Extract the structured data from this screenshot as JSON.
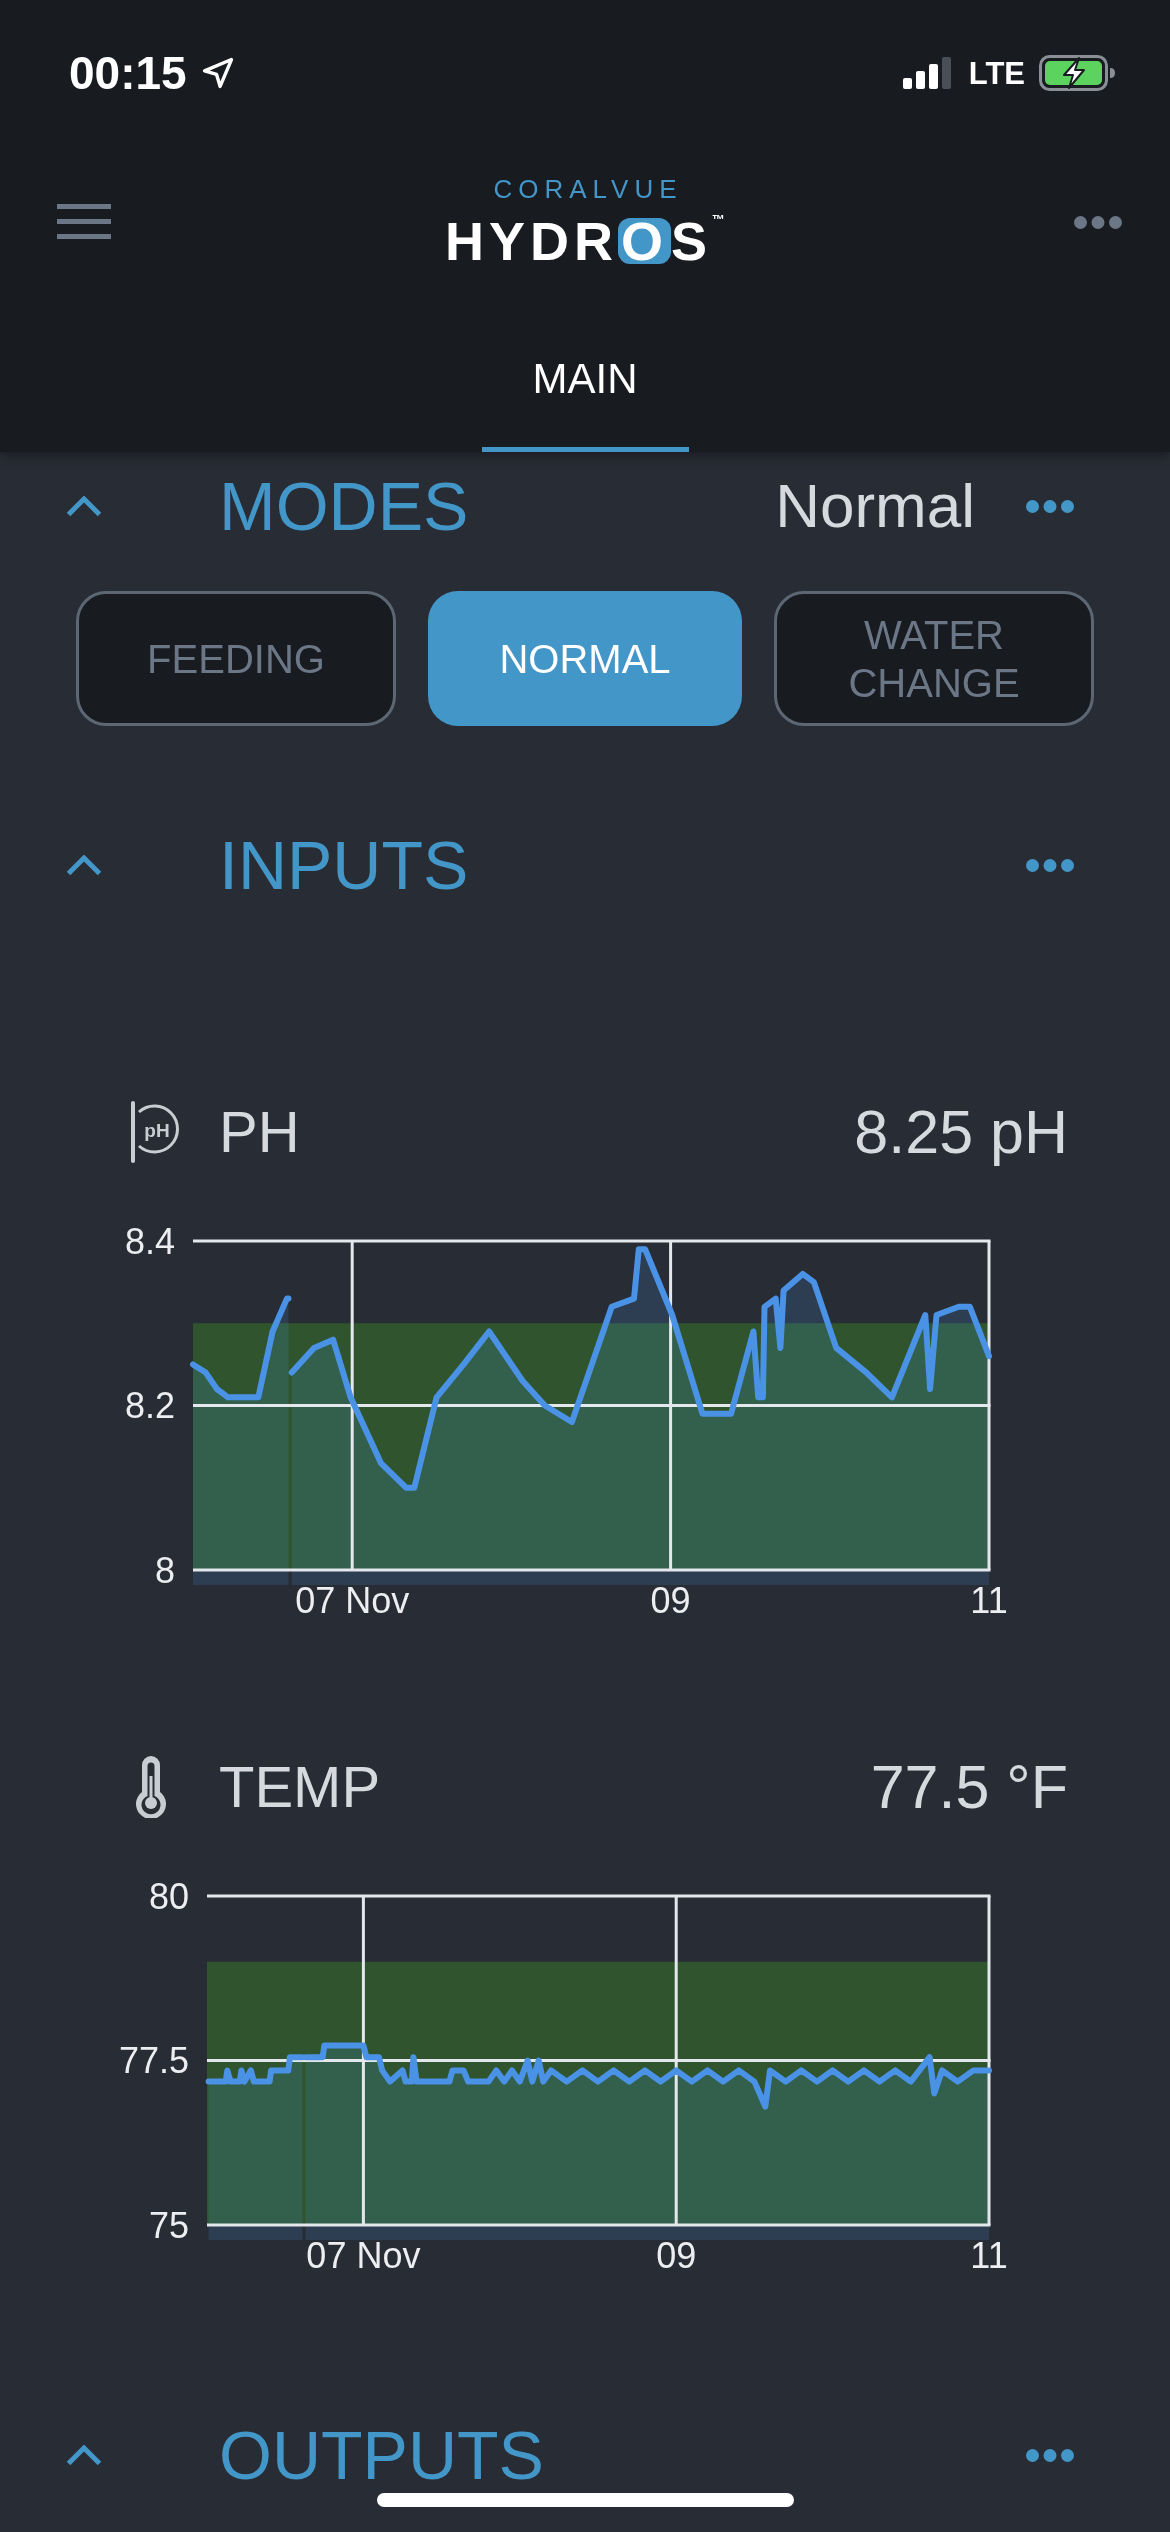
{
  "status_bar": {
    "time": "00:15",
    "network": "LTE"
  },
  "header": {
    "logo": {
      "brand": "CORALVUE",
      "product": "HYDR**O**S$^{™}$"
    },
    "tabs": [
      {
        "label": "MAIN",
        "selected": true
      }
    ]
  },
  "sections": [
    {
      "kind": "modes",
      "title": "MODES",
      "expanded": true,
      "current": "Normal",
      "modes": [
        {
          "label": "FEEDING",
          "selected": false
        },
        {
          "label": "NORMAL",
          "selected": true
        },
        {
          "label": "WATER CHANGE",
          "selected": false
        }
      ]
    },
    {
      "kind": "inputs",
      "title": "INPUTS",
      "expanded": true,
      "inputs": [
        {
          "kind": "ph",
          "name": "PH",
          "icon_text": "pH",
          "reading": "8.25 pH",
          "chart_data": {
            "type": "area",
            "x": [
              6.0,
              6.08,
              6.15,
              6.22,
              6.41,
              6.5,
              6.59,
              6.6,
              6.62,
              6.76,
              6.88,
              6.99,
              7.18,
              7.34,
              7.39,
              7.53,
              7.7,
              7.86,
              8.07,
              8.21,
              8.38,
              8.47,
              8.63,
              8.77,
              8.8,
              8.84,
              9.01,
              9.2,
              9.38,
              9.52,
              9.55,
              9.58,
              9.59,
              9.66,
              9.69,
              9.71,
              9.83,
              9.9,
              10.04,
              10.23,
              10.39,
              10.6,
              10.63,
              10.67,
              10.81,
              10.88,
              11.0
            ],
            "series": [
              {
                "color": "#4a92e6",
                "values": [
                  8.25,
                  8.24,
                  8.22,
                  8.21,
                  8.21,
                  8.29,
                  8.33,
                  null,
                  8.24,
                  8.27,
                  8.28,
                  8.21,
                  8.13,
                  8.1,
                  8.1,
                  8.21,
                  8.25,
                  8.29,
                  8.23,
                  8.2,
                  8.18,
                  8.23,
                  8.32,
                  8.33,
                  8.39,
                  8.39,
                  8.31,
                  8.19,
                  8.19,
                  8.29,
                  8.21,
                  8.21,
                  8.32,
                  8.33,
                  8.27,
                  8.34,
                  8.36,
                  8.35,
                  8.27,
                  8.24,
                  8.21,
                  8.31,
                  8.22,
                  8.31,
                  8.32,
                  8.32,
                  8.26
                ]
              }
            ],
            "xlim": [
              6,
              11
            ],
            "ylim": [
              8,
              8.4
            ],
            "xticks": [
              {
                "value": 7,
                "label": "07 Nov"
              },
              {
                "value": 9,
                "label": "09"
              },
              {
                "value": 11,
                "label": "11"
              }
            ],
            "yticks": [
              8,
              8.2,
              8.4
            ],
            "grid": true,
            "bands": [
              {
                "axis": "y",
                "from": 8,
                "to": 8.3
              }
            ]
          }
        },
        {
          "kind": "temperature",
          "name": "TEMP",
          "reading": "77.5 °F",
          "chart_data": {
            "type": "area",
            "x": [
              6.01,
              6.12,
              6.13,
              6.15,
              6.21,
              6.22,
              6.24,
              6.28,
              6.3,
              6.4,
              6.41,
              6.52,
              6.53,
              6.6,
              6.61,
              6.63,
              6.74,
              6.75,
              7.0,
              7.02,
              7.1,
              7.12,
              7.17,
              7.25,
              7.27,
              7.31,
              7.32,
              7.34,
              7.55,
              7.57,
              7.64,
              7.67,
              7.8,
              7.85,
              7.9,
              7.95,
              8.0,
              8.05,
              8.08,
              8.12,
              8.15,
              8.2,
              8.3,
              8.4,
              8.5,
              8.6,
              8.7,
              8.8,
              8.9,
              9.0,
              9.1,
              9.2,
              9.3,
              9.4,
              9.5,
              9.57,
              9.6,
              9.7,
              9.8,
              9.9,
              10.0,
              10.1,
              10.2,
              10.3,
              10.4,
              10.5,
              10.62,
              10.65,
              10.7,
              10.8,
              10.9,
              11.0
            ],
            "series": [
              {
                "color": "#4a92e6",
                "values": [
                  77.18,
                  77.18,
                  77.35,
                  77.18,
                  77.18,
                  77.35,
                  77.18,
                  77.35,
                  77.18,
                  77.18,
                  77.35,
                  77.35,
                  77.55,
                  77.55,
                  null,
                  77.55,
                  77.55,
                  77.73,
                  77.73,
                  77.55,
                  77.55,
                  77.35,
                  77.18,
                  77.35,
                  77.18,
                  77.18,
                  77.55,
                  77.18,
                  77.18,
                  77.35,
                  77.35,
                  77.18,
                  77.18,
                  77.35,
                  77.18,
                  77.35,
                  77.18,
                  77.5,
                  77.18,
                  77.5,
                  77.18,
                  77.35,
                  77.18,
                  77.35,
                  77.18,
                  77.35,
                  77.18,
                  77.35,
                  77.18,
                  77.35,
                  77.18,
                  77.35,
                  77.18,
                  77.35,
                  77.18,
                  76.8,
                  77.35,
                  77.18,
                  77.35,
                  77.18,
                  77.35,
                  77.18,
                  77.35,
                  77.18,
                  77.35,
                  77.18,
                  77.55,
                  77.0,
                  77.35,
                  77.18,
                  77.35,
                  77.35
                ]
              }
            ],
            "xlim": [
              6,
              11
            ],
            "ylim": [
              75,
              80
            ],
            "xticks": [
              {
                "value": 7,
                "label": "07 Nov"
              },
              {
                "value": 9,
                "label": "09"
              },
              {
                "value": 11,
                "label": "11"
              }
            ],
            "yticks": [
              75,
              77.5,
              80
            ],
            "grid": true,
            "bands": [
              {
                "axis": "y",
                "from": 75,
                "to": 79
              }
            ]
          }
        }
      ]
    },
    {
      "kind": "outputs",
      "title": "OUTPUTS",
      "expanded": true
    }
  ]
}
